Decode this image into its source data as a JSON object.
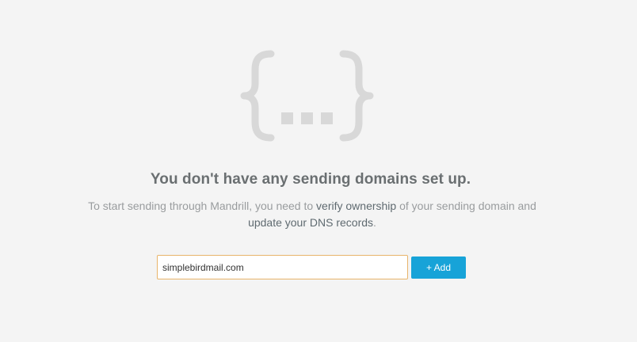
{
  "empty_state": {
    "illustration_icon": "curly-braces-ellipsis-icon",
    "illustration_color": "#d8d8d8",
    "headline": "You don't have any sending domains set up.",
    "description_prefix": "To start sending through Mandrill, you need to ",
    "verify_link": "verify ownership",
    "description_middle": " of your sending domain and ",
    "dns_link": "update your DNS records",
    "description_suffix": "."
  },
  "domain_form": {
    "input_value": "simplebirdmail.com",
    "add_label": "+ Add",
    "accent_color": "#17a3d8",
    "input_border_color": "#e8b46a"
  }
}
